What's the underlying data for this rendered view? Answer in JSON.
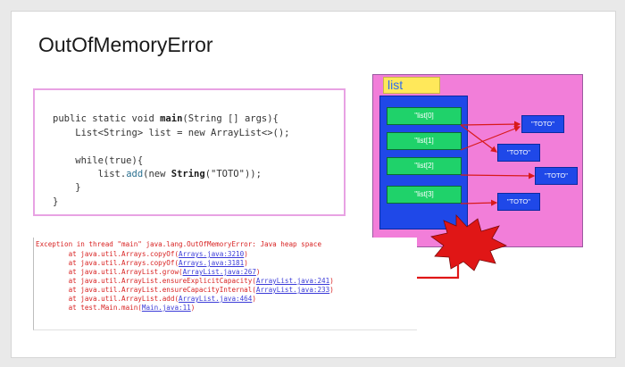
{
  "slide": {
    "title": "OutOfMemoryError"
  },
  "code": {
    "lines": [
      [
        "public static void ",
        "main",
        "(String [] args){"
      ],
      [
        "    List<String> list = new ArrayList<>();"
      ],
      [
        ""
      ],
      [
        "    while(true){"
      ],
      [
        "        list.",
        "add",
        "(new ",
        "String",
        "(\"TOTO\"));"
      ],
      [
        "    }"
      ],
      [
        "}"
      ]
    ]
  },
  "diagram": {
    "label": "list",
    "slots": [
      "\"list[0]",
      "\"list[1]",
      "\"list[2]",
      "\"list[3]"
    ],
    "toto": [
      "\"TOTO\"",
      "\"TOTO\"",
      "\"TOTO\"",
      "\"TOTO\""
    ],
    "colors": {
      "background": "#f27ed9",
      "frame": "#1f48e8",
      "slot": "#1fd26a",
      "label": "#ffe85a",
      "arrow": "#d81a1a"
    }
  },
  "console": {
    "header": "Exception in thread \"main\" java.lang.OutOfMemoryError: Java heap space",
    "frames": [
      {
        "text": "at java.util.Arrays.copyOf(",
        "link": "Arrays.java:3210",
        "end": ")"
      },
      {
        "text": "at java.util.Arrays.copyOf(",
        "link": "Arrays.java:3181",
        "end": ")"
      },
      {
        "text": "at java.util.ArrayList.grow(",
        "link": "ArrayList.java:267",
        "end": ")"
      },
      {
        "text": "at java.util.ArrayList.ensureExplicitCapacity(",
        "link": "ArrayList.java:241",
        "end": ")"
      },
      {
        "text": "at java.util.ArrayList.ensureCapacityInternal(",
        "link": "ArrayList.java:233",
        "end": ")"
      },
      {
        "text": "at java.util.ArrayList.add(",
        "link": "ArrayList.java:464",
        "end": ")"
      },
      {
        "text": "at test.Main.main(",
        "link": "Main.java:11",
        "end": ")"
      }
    ],
    "colors": {
      "error": "#d82222",
      "link": "#3a3ad8"
    }
  }
}
